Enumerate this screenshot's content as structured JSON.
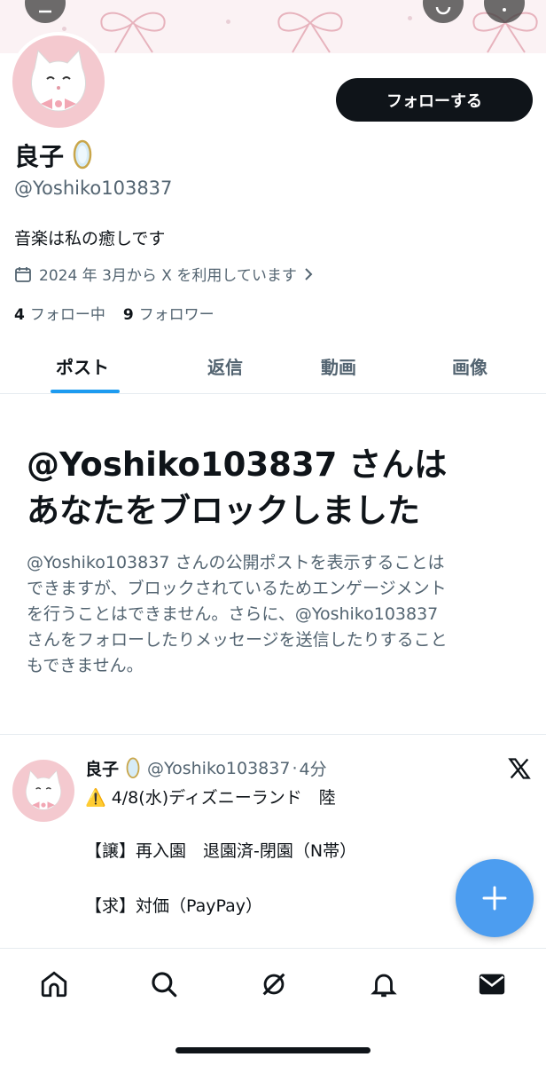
{
  "profile": {
    "name": "良子",
    "handle": "@Yoshiko103837",
    "bio": "音楽は私の癒しです",
    "joined": "2024 年 3月から X を利用しています",
    "following_count": "4",
    "following_label": "フォロー中",
    "followers_count": "9",
    "followers_label": "フォロワー",
    "follow_button": "フォローする",
    "badge_icon": "mirror-badge-icon"
  },
  "tabs": [
    {
      "label": "ポスト",
      "active": true
    },
    {
      "label": "返信",
      "active": false
    },
    {
      "label": "動画",
      "active": false
    },
    {
      "label": "画像",
      "active": false
    }
  ],
  "blocked": {
    "title_line1": "@Yoshiko103837 さんは",
    "title_line2": "あなたをブロックしました",
    "description_lines": [
      "@Yoshiko103837 さんの公開ポストを表示することは",
      "できますが、ブロックされているためエンゲージメント",
      "を行うことはできません。さらに、@Yoshiko103837",
      "さんをフォローしたりメッセージを送信したりすること",
      "もできません。"
    ]
  },
  "post": {
    "name": "良子",
    "handle": "@Yoshiko103837",
    "separator": "·",
    "time": "4分",
    "line1": "⚠️ 4/8(水)ディズニーランド　陸",
    "line2": "【譲】再入園　退園済-閉園（N帯）",
    "line3": "【求】対価（PayPay）"
  },
  "colors": {
    "accent": "#1d9bf0",
    "fab": "#4c9df0",
    "text_primary": "#0f1419",
    "text_secondary": "#536471",
    "avatar_bg": "#f4c9cf"
  },
  "nav": [
    "home-icon",
    "search-icon",
    "grok-icon",
    "notifications-icon",
    "messages-icon"
  ]
}
